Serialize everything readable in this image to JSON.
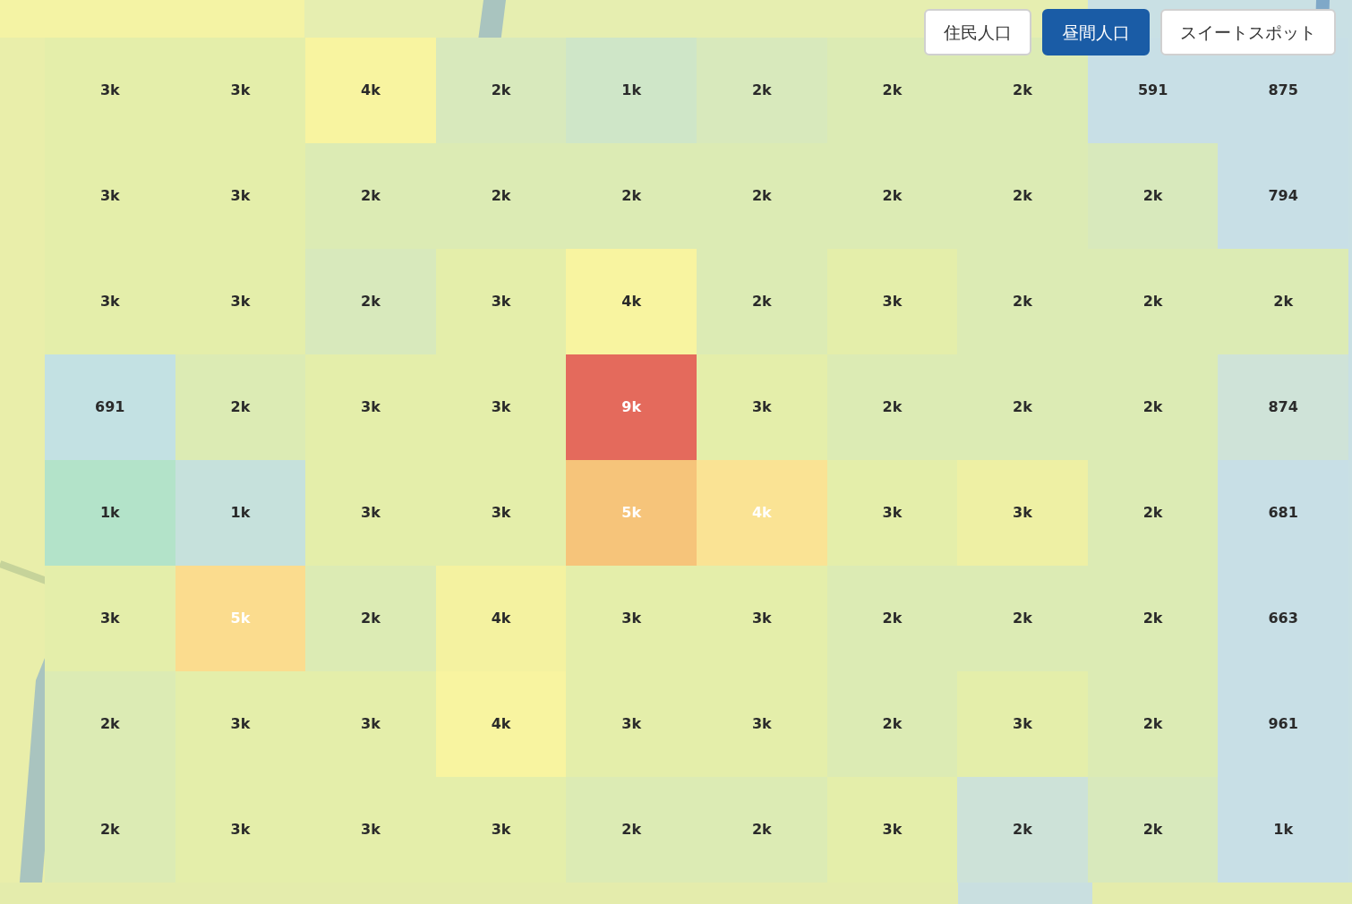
{
  "view_buttons": [
    {
      "label": "住民人口",
      "selected": false
    },
    {
      "label": "昼間人口",
      "selected": true
    },
    {
      "label": "スイートスポット",
      "selected": false
    }
  ],
  "grid": {
    "rows": [
      {
        "cells": [
          {
            "value": "3k",
            "color": "#e4eeaa"
          },
          {
            "value": "3k",
            "color": "#e4eeaa"
          },
          {
            "value": "4k",
            "color": "#f8f4a0"
          },
          {
            "value": "2k",
            "color": "#d8e9bc"
          },
          {
            "value": "1k",
            "color": "#cfe6c8"
          },
          {
            "value": "2k",
            "color": "#d8e9bc"
          },
          {
            "value": "2k",
            "color": "#dcebb4"
          },
          {
            "value": "2k",
            "color": "#dcebb4"
          },
          {
            "value": "591",
            "color": "#c8dfe6"
          },
          {
            "value": "875",
            "color": "#c8dfe6"
          }
        ]
      },
      {
        "cells": [
          {
            "value": "3k",
            "color": "#e4eeaa"
          },
          {
            "value": "3k",
            "color": "#e4eeaa"
          },
          {
            "value": "2k",
            "color": "#dcebb4"
          },
          {
            "value": "2k",
            "color": "#dcebb4"
          },
          {
            "value": "2k",
            "color": "#dcebb4"
          },
          {
            "value": "2k",
            "color": "#dcebb4"
          },
          {
            "value": "2k",
            "color": "#dcebb4"
          },
          {
            "value": "2k",
            "color": "#dcebb4"
          },
          {
            "value": "2k",
            "color": "#d8e9bc"
          },
          {
            "value": "794",
            "color": "#c8dfe6"
          }
        ]
      },
      {
        "cells": [
          {
            "value": "3k",
            "color": "#e4eeaa"
          },
          {
            "value": "3k",
            "color": "#e4eeaa"
          },
          {
            "value": "2k",
            "color": "#d8e9bc"
          },
          {
            "value": "3k",
            "color": "#e4eeaa"
          },
          {
            "value": "4k",
            "color": "#f8f4a0"
          },
          {
            "value": "2k",
            "color": "#dcebb4"
          },
          {
            "value": "3k",
            "color": "#e4eeaa"
          },
          {
            "value": "2k",
            "color": "#dcebb4"
          },
          {
            "value": "2k",
            "color": "#dcebb4"
          },
          {
            "value": "2k",
            "color": "#dcebb4"
          }
        ]
      },
      {
        "cells": [
          {
            "value": "691",
            "color": "#c3e1e3"
          },
          {
            "value": "2k",
            "color": "#dcebb4"
          },
          {
            "value": "3k",
            "color": "#e4eeaa"
          },
          {
            "value": "3k",
            "color": "#e4eeaa"
          },
          {
            "value": "9k",
            "color": "#e46a5c"
          },
          {
            "value": "3k",
            "color": "#e4eeaa"
          },
          {
            "value": "2k",
            "color": "#dcebb4"
          },
          {
            "value": "2k",
            "color": "#dcebb4"
          },
          {
            "value": "2k",
            "color": "#dcebb4"
          },
          {
            "value": "874",
            "color": "#cfe3d8"
          }
        ]
      },
      {
        "cells": [
          {
            "value": "1k",
            "color": "#b3e3c9"
          },
          {
            "value": "1k",
            "color": "#c6e1dc"
          },
          {
            "value": "3k",
            "color": "#e4eeaa"
          },
          {
            "value": "3k",
            "color": "#e4eeaa"
          },
          {
            "value": "5k",
            "color": "#f6c47a"
          },
          {
            "value": "4k",
            "color": "#fae394"
          },
          {
            "value": "3k",
            "color": "#e4eeaa"
          },
          {
            "value": "3k",
            "color": "#eef0a4"
          },
          {
            "value": "2k",
            "color": "#dcebb4"
          },
          {
            "value": "681",
            "color": "#c8dfe6"
          }
        ]
      },
      {
        "cells": [
          {
            "value": "3k",
            "color": "#e4eeaa"
          },
          {
            "value": "5k",
            "color": "#fbdc8e"
          },
          {
            "value": "2k",
            "color": "#dcebb4"
          },
          {
            "value": "4k",
            "color": "#f4f2a0"
          },
          {
            "value": "3k",
            "color": "#e4eeaa"
          },
          {
            "value": "3k",
            "color": "#e4eeaa"
          },
          {
            "value": "2k",
            "color": "#dcebb4"
          },
          {
            "value": "2k",
            "color": "#dcebb4"
          },
          {
            "value": "2k",
            "color": "#dcebb4"
          },
          {
            "value": "663",
            "color": "#c8dfe6"
          }
        ]
      },
      {
        "cells": [
          {
            "value": "2k",
            "color": "#dcebb4"
          },
          {
            "value": "3k",
            "color": "#e4eeaa"
          },
          {
            "value": "3k",
            "color": "#e4eeaa"
          },
          {
            "value": "4k",
            "color": "#f8f4a0"
          },
          {
            "value": "3k",
            "color": "#e4eeaa"
          },
          {
            "value": "3k",
            "color": "#e4eeaa"
          },
          {
            "value": "2k",
            "color": "#dcebb4"
          },
          {
            "value": "3k",
            "color": "#e4eeaa"
          },
          {
            "value": "2k",
            "color": "#dcebb4"
          },
          {
            "value": "961",
            "color": "#c8dfe6"
          }
        ]
      },
      {
        "cells": [
          {
            "value": "2k",
            "color": "#dcebb4"
          },
          {
            "value": "3k",
            "color": "#e4eeaa"
          },
          {
            "value": "3k",
            "color": "#e4eeaa"
          },
          {
            "value": "3k",
            "color": "#e4eeaa"
          },
          {
            "value": "2k",
            "color": "#dcebb4"
          },
          {
            "value": "2k",
            "color": "#dcebb4"
          },
          {
            "value": "3k",
            "color": "#e4eeaa"
          },
          {
            "value": "2k",
            "color": "#cde2d8"
          },
          {
            "value": "2k",
            "color": "#d8e9bc"
          },
          {
            "value": "1k",
            "color": "#c8dfe6"
          }
        ]
      }
    ]
  }
}
